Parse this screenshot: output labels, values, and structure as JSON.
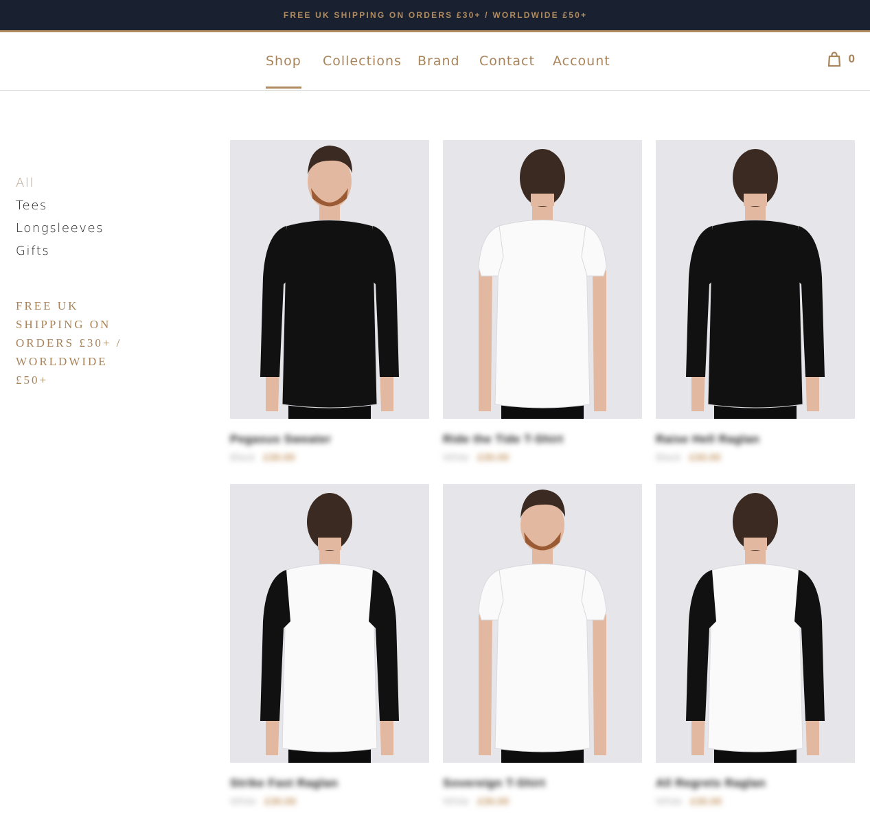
{
  "topbar": {
    "text": "FREE UK SHIPPING ON ORDERS £30+ / WORLDWIDE £50+"
  },
  "nav": {
    "items": [
      {
        "label": "Shop",
        "active": true
      },
      {
        "label": "Collections",
        "active": false
      },
      {
        "label": "Brand",
        "active": false
      },
      {
        "label": "Contact",
        "active": false
      },
      {
        "label": "Account",
        "active": false
      }
    ]
  },
  "cart": {
    "icon": "shopping-bag-icon",
    "count": "0"
  },
  "sidebar": {
    "categories": [
      {
        "label": "All",
        "active": true
      },
      {
        "label": "Tees",
        "active": false
      },
      {
        "label": "Longsleeves",
        "active": false
      },
      {
        "label": "Gifts",
        "active": false
      }
    ],
    "promo": "FREE UK SHIPPING ON ORDERS £30+ / WORLDWIDE £50+"
  },
  "products": [
    {
      "name": "Pegasus Sweater",
      "color": "Black",
      "price": "£30.00",
      "shirt": "black",
      "sleeves": "black",
      "view": "front"
    },
    {
      "name": "Ride the Tide T-Shirt",
      "color": "White",
      "price": "£30.00",
      "shirt": "white",
      "sleeves": "short",
      "view": "back"
    },
    {
      "name": "Raise Hell Raglan",
      "color": "Black",
      "price": "£30.00",
      "shirt": "black",
      "sleeves": "black",
      "view": "back"
    },
    {
      "name": "Strike Fast Raglan",
      "color": "White",
      "price": "£30.00",
      "shirt": "white",
      "sleeves": "black",
      "view": "back"
    },
    {
      "name": "Sovereign T-Shirt",
      "color": "White",
      "price": "£30.00",
      "shirt": "white",
      "sleeves": "short",
      "view": "front"
    },
    {
      "name": "All Regrets Raglan",
      "color": "White",
      "price": "£30.00",
      "shirt": "white",
      "sleeves": "black",
      "view": "back"
    }
  ],
  "colors": {
    "navy": "#192130",
    "gold": "#b08b5f",
    "photo_bg": "#e6e6ea"
  }
}
